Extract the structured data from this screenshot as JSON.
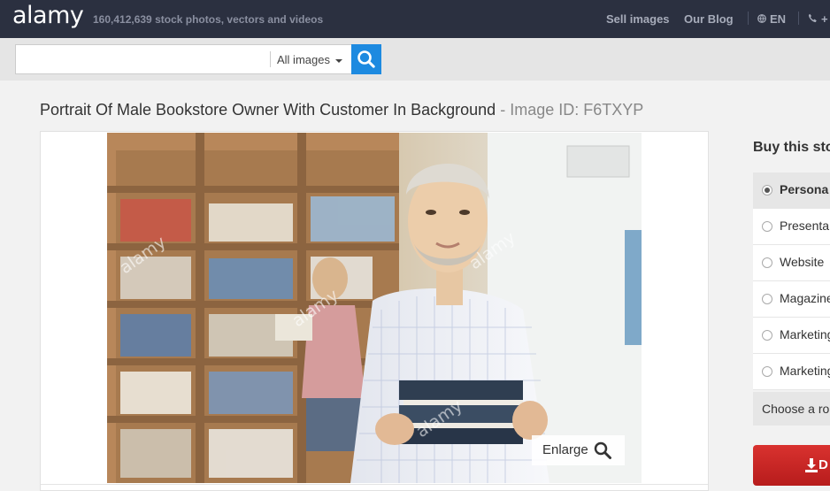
{
  "header": {
    "logo": "alamy",
    "stock_count": "160,412,639  stock photos, vectors and videos",
    "nav": {
      "sell": "Sell images",
      "blog": "Our Blog",
      "lang": "EN",
      "phone": "+"
    }
  },
  "search": {
    "value": "",
    "placeholder": "",
    "scope": "All images"
  },
  "page": {
    "title": "Portrait Of Male Bookstore Owner With Customer In Background",
    "id_sep": " - ",
    "image_id": "Image ID: F6TXYP"
  },
  "viewer": {
    "enlarge": "Enlarge",
    "watermark": "alamy"
  },
  "buy": {
    "title": "Buy this sto",
    "options": [
      {
        "label": "Persona",
        "selected": true
      },
      {
        "label": "Presenta",
        "selected": false
      },
      {
        "label": "Website ",
        "selected": false
      },
      {
        "label": "Magazine",
        "selected": false
      },
      {
        "label": "Marketing",
        "selected": false
      },
      {
        "label": "Marketing",
        "selected": false
      }
    ],
    "choose": "Choose a ro",
    "download": "D"
  },
  "colors": {
    "topbar": "#2b3040",
    "search_button": "#1d8ae0",
    "download_button": "#c62828"
  },
  "icons": [
    "globe-icon",
    "phone-icon",
    "search-icon",
    "caret-down-icon",
    "magnifier-icon",
    "download-icon"
  ]
}
